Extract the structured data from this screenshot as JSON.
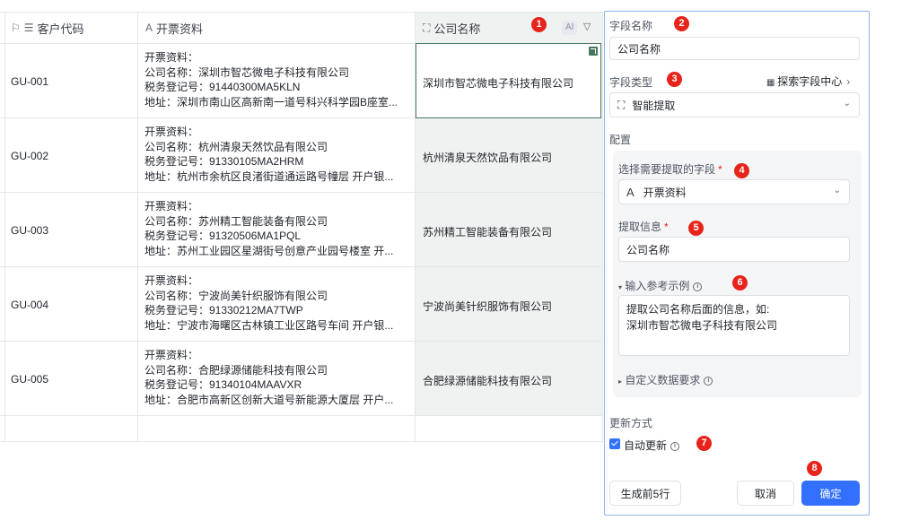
{
  "table": {
    "columns": {
      "code": "客户代码",
      "invoice": "开票资料",
      "company": "公司名称",
      "ai_tag": "AI"
    },
    "rows": [
      {
        "code": "GU-001",
        "invoice": [
          "开票资料：",
          "公司名称：深圳市智芯微电子科技有限公司",
          "税务登记号：91440300MA5KLN",
          "地址：深圳市南山区高新南一道号科兴科学园B座室..."
        ],
        "company": "深圳市智芯微电子科技有限公司"
      },
      {
        "code": "GU-002",
        "invoice": [
          "开票资料：",
          "公司名称：杭州清泉天然饮品有限公司",
          "税务登记号：91330105MA2HRM",
          "地址：杭州市余杭区良渚街道通运路号幢层 开户银..."
        ],
        "company": "杭州清泉天然饮品有限公司"
      },
      {
        "code": "GU-003",
        "invoice": [
          "开票资料：",
          "公司名称：苏州精工智能装备有限公司",
          "税务登记号：91320506MA1PQL",
          "地址：苏州工业园区星湖街号创意产业园号楼室 开..."
        ],
        "company": "苏州精工智能装备有限公司"
      },
      {
        "code": "GU-004",
        "invoice": [
          "开票资料：",
          "公司名称：宁波尚美针织服饰有限公司",
          "税务登记号：91330212MA7TWP",
          "地址：宁波市海曙区古林镇工业区路号车间 开户银..."
        ],
        "company": "宁波尚美针织服饰有限公司"
      },
      {
        "code": "GU-005",
        "invoice": [
          "开票资料：",
          "公司名称：合肥绿源储能科技有限公司",
          "税务登记号：91340104MAAVXR",
          "地址：合肥市高新区创新大道号新能源大厦层 开户..."
        ],
        "company": "合肥绿源储能科技有限公司"
      }
    ]
  },
  "badges": [
    "1",
    "2",
    "3",
    "4",
    "5",
    "6",
    "7",
    "8"
  ],
  "panel": {
    "field_name_label": "字段名称",
    "field_name_value": "公司名称",
    "field_type_label": "字段类型",
    "explore_link": "探索字段中心",
    "field_type_value": "智能提取",
    "config_label": "配置",
    "select_field_label": "选择需要提取的字段",
    "select_field_value": "开票资料",
    "extract_label": "提取信息",
    "extract_value": "公司名称",
    "example_label": "输入参考示例",
    "example_line1": "提取公司名称后面的信息，如:",
    "example_line2": "深圳市智芯微电子科技有限公司",
    "custom_label": "自定义数据要求",
    "update_label": "更新方式",
    "auto_update": "自动更新",
    "gen_btn": "生成前5行",
    "cancel_btn": "取消",
    "ok_btn": "确定"
  },
  "colors": {
    "accent": "#3370ff",
    "badge": "#e8231a",
    "active_cell": "#47785f"
  }
}
